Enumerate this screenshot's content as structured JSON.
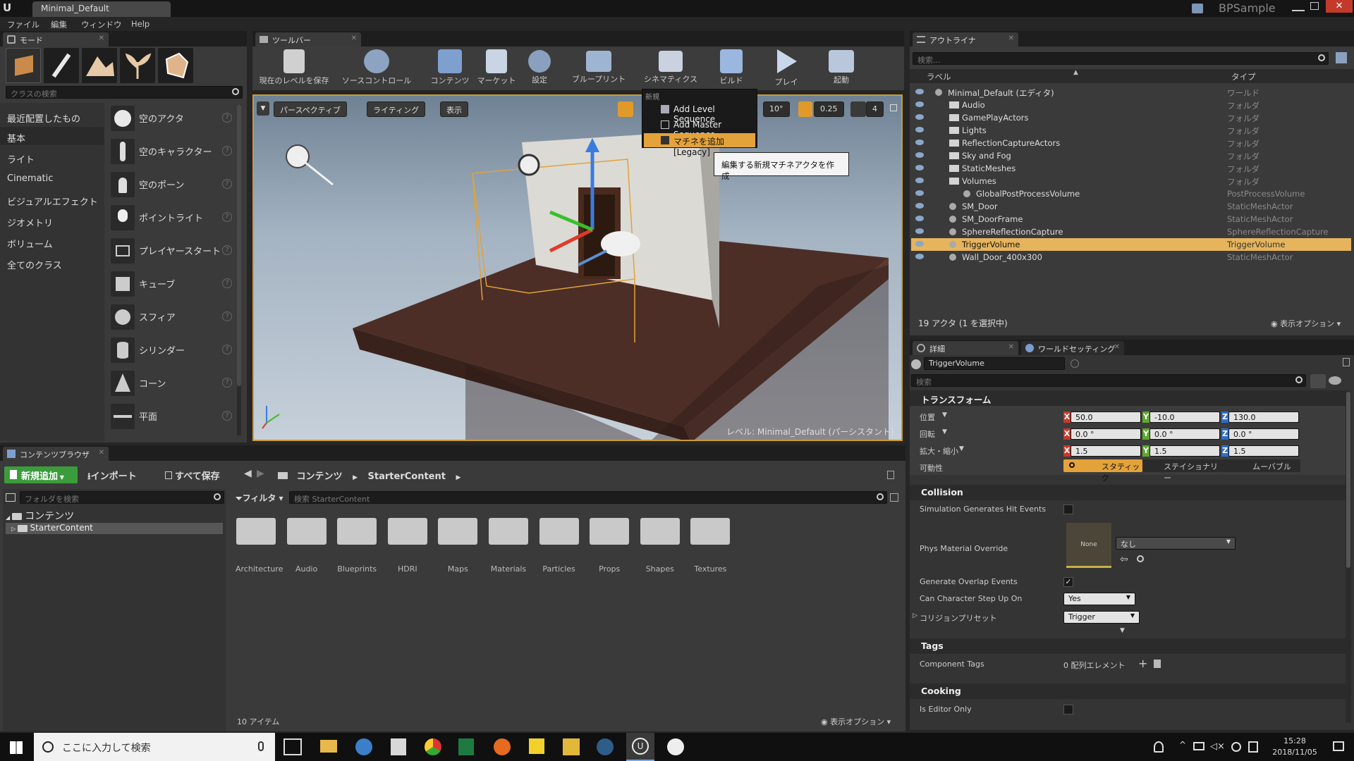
{
  "title_bar": {
    "tab_title": "Minimal_Default",
    "project_name": "BPSample"
  },
  "menu": [
    "ファイル",
    "編集",
    "ウィンドウ",
    "Help"
  ],
  "modes": {
    "tab": "モード",
    "search_placeholder": "クラスの検索",
    "categories": [
      "最近配置したもの",
      "基本",
      "ライト",
      "Cinematic",
      "ビジュアルエフェクト",
      "ジオメトリ",
      "ボリューム",
      "全てのクラス"
    ],
    "items": [
      "空のアクタ",
      "空のキャラクター",
      "空のポーン",
      "ポイントライト",
      "プレイヤースタート",
      "キューブ",
      "スフィア",
      "シリンダー",
      "コーン",
      "平面"
    ],
    "help_glyph": "?"
  },
  "toolbar": {
    "tab": "ツールバー",
    "buttons": [
      "現在のレベルを保存",
      "ソースコントロール",
      "コンテンツ",
      "マーケット",
      "設定",
      "ブループリント",
      "シネマティクス",
      "ビルド",
      "プレイ",
      "起動"
    ]
  },
  "viewport": {
    "buttons": [
      "パースペクティブ",
      "ライティング",
      "表示"
    ],
    "snap_angle": "10°",
    "snap_scale": "0.25",
    "camera_speed": "4",
    "level_label": "レベル:",
    "level_name": "Minimal_Default (パーシスタント)"
  },
  "dropdown": {
    "header": "新規",
    "items": [
      "Add Level Sequence",
      "Add Master Sequence",
      "マチネを追加 [Legacy]"
    ],
    "tooltip": "編集する新規マチネアクタを作成"
  },
  "outliner": {
    "tab": "アウトライナ",
    "search_placeholder": "検索...",
    "col_label": "ラベル",
    "col_type": "タイプ",
    "rows": [
      {
        "label": "Minimal_Default (エディタ)",
        "type": "ワールド"
      },
      {
        "label": "Audio",
        "type": "フォルダ"
      },
      {
        "label": "GamePlayActors",
        "type": "フォルダ"
      },
      {
        "label": "Lights",
        "type": "フォルダ"
      },
      {
        "label": "ReflectionCaptureActors",
        "type": "フォルダ"
      },
      {
        "label": "Sky and Fog",
        "type": "フォルダ"
      },
      {
        "label": "StaticMeshes",
        "type": "フォルダ"
      },
      {
        "label": "Volumes",
        "type": "フォルダ"
      },
      {
        "label": "GlobalPostProcessVolume",
        "type": "PostProcessVolume"
      },
      {
        "label": "SM_Door",
        "type": "StaticMeshActor"
      },
      {
        "label": "SM_DoorFrame",
        "type": "StaticMeshActor"
      },
      {
        "label": "SphereReflectionCapture",
        "type": "SphereReflectionCapture"
      },
      {
        "label": "TriggerVolume",
        "type": "TriggerVolume"
      },
      {
        "label": "Wall_Door_400x300",
        "type": "StaticMeshActor"
      }
    ],
    "footer_count": "19 アクタ (1 を選択中)",
    "view_options": "表示オプション"
  },
  "details": {
    "tab": "詳細",
    "tab2": "ワールドセッティング",
    "object_name": "TriggerVolume",
    "search_placeholder": "検索",
    "transform_header": "トランスフォーム",
    "location_label": "位置",
    "rotation_label": "回転",
    "scale_label": "拡大・縮小",
    "mobility_label": "可動性",
    "location": [
      "50.0",
      "-10.0",
      "130.0"
    ],
    "rotation": [
      "0.0 °",
      "0.0 °",
      "0.0 °"
    ],
    "scale": [
      "1.5",
      "1.5",
      "1.5"
    ],
    "mobility": [
      "スタティック",
      "ステイショナリー",
      "ムーバブル"
    ],
    "collision_header": "Collision",
    "sim_hit": "Simulation Generates Hit Events",
    "phys_material": "Phys Material Override",
    "phys_none": "None",
    "phys_select": "なし",
    "overlap": "Generate Overlap Events",
    "step_up": "Can Character Step Up On",
    "step_up_value": "Yes",
    "preset": "コリジョンプリセット",
    "preset_value": "Trigger",
    "tags_header": "Tags",
    "component_tags": "Component Tags",
    "array_elements": "0 配列エレメント",
    "cooking_header": "Cooking",
    "editor_only": "Is Editor Only",
    "axis_labels": [
      "X",
      "Y",
      "Z"
    ]
  },
  "content_browser": {
    "tab": "コンテンツブラウザ",
    "add_new": "新規追加",
    "import": "インポート",
    "save_all": "すべて保存",
    "path": [
      "コンテンツ",
      "StarterContent"
    ],
    "folder_search": "フォルダを検索",
    "filter": "フィルタ",
    "search_placeholder": "検索 StarterContent",
    "tree_root": "コンテンツ",
    "tree_child": "StarterContent",
    "folders": [
      "Architecture",
      "Audio",
      "Blueprints",
      "HDRI",
      "Maps",
      "Materials",
      "Particles",
      "Props",
      "Shapes",
      "Textures"
    ],
    "item_count": "10 アイテム",
    "view_options": "表示オプション"
  },
  "taskbar": {
    "search": "ここに入力して検索",
    "time": "15:28",
    "date": "2018/11/05"
  }
}
